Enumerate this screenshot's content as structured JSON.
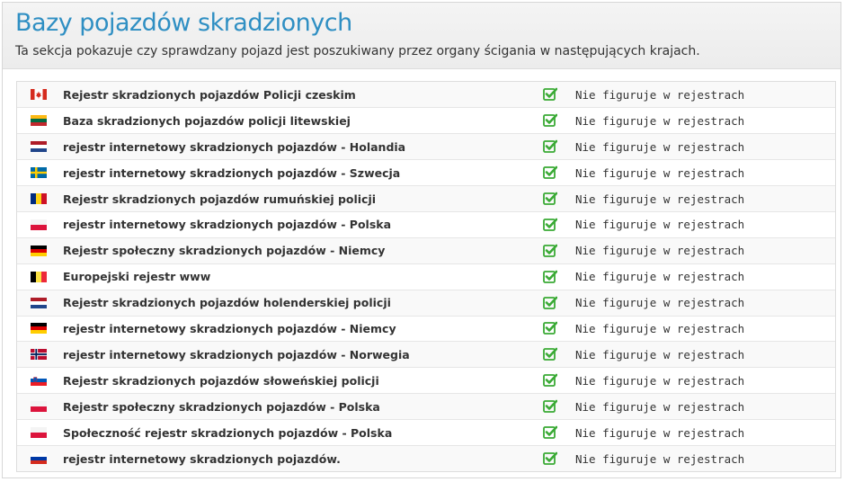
{
  "header": {
    "title": "Bazy pojazdów skradzionych",
    "subtitle": "Ta sekcja pokazuje czy sprawdzany pojazd jest poszukiwany przez organy ścigania w następujących krajach."
  },
  "colors": {
    "title": "#2f8fc3",
    "check": "#3aaa35"
  },
  "databases": [
    {
      "flag": "canada-flag-icon",
      "name": "Rejestr skradzionych pojazdów Policji czeskim",
      "status": "Nie figuruje w rejestrach"
    },
    {
      "flag": "lithuania-flag-icon",
      "name": "Baza skradzionych pojazdów policji litewskiej",
      "status": "Nie figuruje w rejestrach"
    },
    {
      "flag": "netherlands-flag-icon",
      "name": "rejestr internetowy skradzionych pojazdów - Holandia",
      "status": "Nie figuruje w rejestrach"
    },
    {
      "flag": "sweden-flag-icon",
      "name": "rejestr internetowy skradzionych pojazdów - Szwecja",
      "status": "Nie figuruje w rejestrach"
    },
    {
      "flag": "romania-flag-icon",
      "name": "Rejestr skradzionych pojazdów rumuńskiej policji",
      "status": "Nie figuruje w rejestrach"
    },
    {
      "flag": "poland-flag-icon",
      "name": "rejestr internetowy skradzionych pojazdów - Polska",
      "status": "Nie figuruje w rejestrach"
    },
    {
      "flag": "germany-flag-icon",
      "name": "Rejestr społeczny skradzionych pojazdów - Niemcy",
      "status": "Nie figuruje w rejestrach"
    },
    {
      "flag": "belgium-flag-icon",
      "name": "Europejski rejestr www",
      "status": "Nie figuruje w rejestrach"
    },
    {
      "flag": "netherlands-flag-icon",
      "name": "Rejestr skradzionych pojazdów holenderskiej policji",
      "status": "Nie figuruje w rejestrach"
    },
    {
      "flag": "germany-flag-icon",
      "name": "rejestr internetowy skradzionych pojazdów - Niemcy",
      "status": "Nie figuruje w rejestrach"
    },
    {
      "flag": "norway-flag-icon",
      "name": "rejestr internetowy skradzionych pojazdów - Norwegia",
      "status": "Nie figuruje w rejestrach"
    },
    {
      "flag": "slovenia-flag-icon",
      "name": "Rejestr skradzionych pojazdów słoweńskiej policji",
      "status": "Nie figuruje w rejestrach"
    },
    {
      "flag": "poland-flag-icon",
      "name": "Rejestr społeczny skradzionych pojazdów - Polska",
      "status": "Nie figuruje w rejestrach"
    },
    {
      "flag": "poland-flag-icon",
      "name": "Społeczność rejestr skradzionych pojazdów - Polska",
      "status": "Nie figuruje w rejestrach"
    },
    {
      "flag": "russia-flag-icon",
      "name": "rejestr internetowy skradzionych pojazdów.",
      "status": "Nie figuruje w rejestrach"
    }
  ]
}
